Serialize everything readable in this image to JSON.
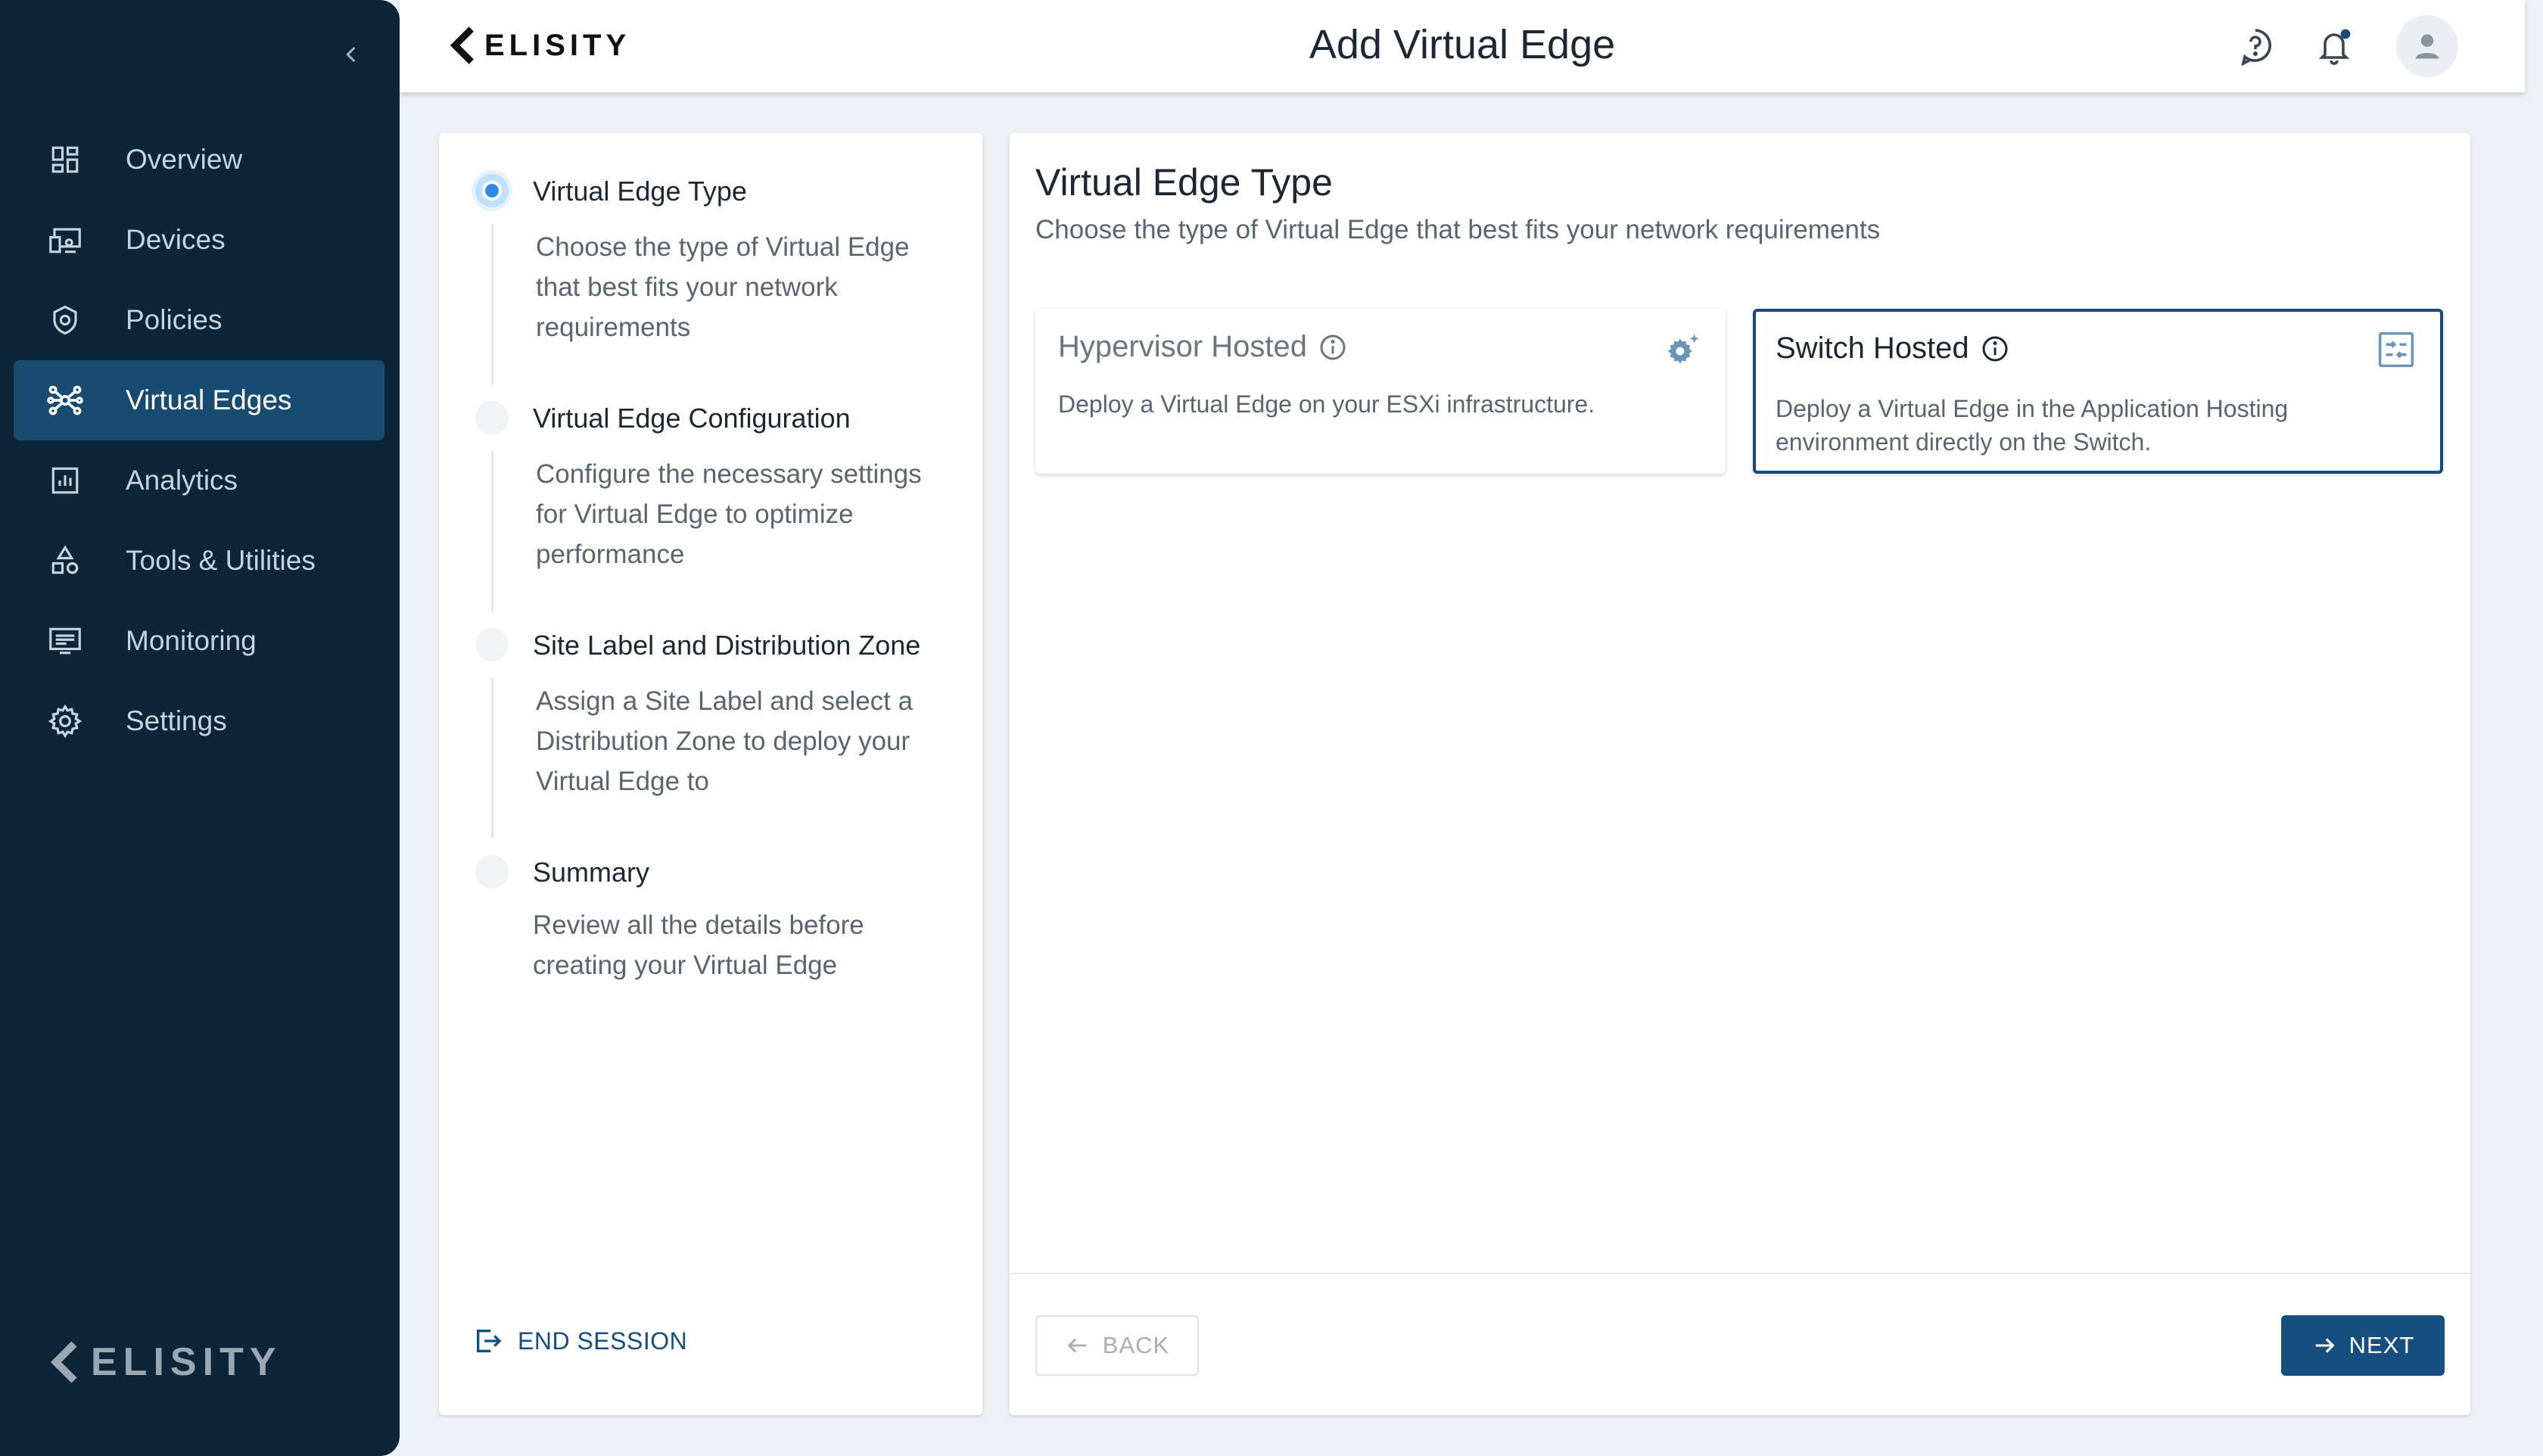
{
  "brand": {
    "name": "ELISITY",
    "logo_icon": "elisity-chevron-logo"
  },
  "header": {
    "title": "Add Virtual Edge",
    "icons": [
      "help-icon",
      "notification-bell-icon",
      "user-avatar-icon"
    ]
  },
  "sidebar": {
    "collapse_icon": "chevron-left-icon",
    "items": [
      {
        "label": "Overview",
        "icon": "dashboard-icon",
        "active": false
      },
      {
        "label": "Devices",
        "icon": "devices-icon",
        "active": false
      },
      {
        "label": "Policies",
        "icon": "shield-icon",
        "active": false
      },
      {
        "label": "Virtual Edges",
        "icon": "network-hub-icon",
        "active": true
      },
      {
        "label": "Analytics",
        "icon": "analytics-icon",
        "active": false
      },
      {
        "label": "Tools & Utilities",
        "icon": "tools-icon",
        "active": false
      },
      {
        "label": "Monitoring",
        "icon": "monitor-icon",
        "active": false
      },
      {
        "label": "Settings",
        "icon": "gear-icon",
        "active": false
      }
    ]
  },
  "stepper": {
    "steps": [
      {
        "title": "Virtual Edge Type",
        "description": "Choose the type of Virtual Edge that best fits your network requirements",
        "active": true
      },
      {
        "title": "Virtual Edge Configuration",
        "description": "Configure the necessary settings for Virtual Edge to optimize performance",
        "active": false
      },
      {
        "title": "Site Label and Distribution Zone",
        "description": "Assign a Site Label and select a Distribution Zone to deploy your Virtual Edge to",
        "active": false
      },
      {
        "title": "Summary",
        "description": "Review all the details before creating your Virtual Edge",
        "active": false
      }
    ],
    "end_session_label": "END SESSION"
  },
  "main": {
    "title": "Virtual Edge Type",
    "subtitle": "Choose the type of Virtual Edge that best fits your network requirements",
    "cards": [
      {
        "title": "Hypervisor Hosted",
        "description": "Deploy a Virtual Edge on your ESXi infrastructure.",
        "icon": "gear-sparkle-icon",
        "selected": false
      },
      {
        "title": "Switch Hosted",
        "description": "Deploy a Virtual Edge in the Application Hosting environment directly on the Switch.",
        "icon": "switch-settings-icon",
        "selected": true
      }
    ],
    "back_label": "BACK",
    "next_label": "NEXT"
  },
  "colors": {
    "sidebar_bg": "#0c2538",
    "sidebar_active": "#174b6f",
    "primary": "#164f7f",
    "step_active": "#2f8ce5",
    "notification_dot": "#174b7e"
  }
}
